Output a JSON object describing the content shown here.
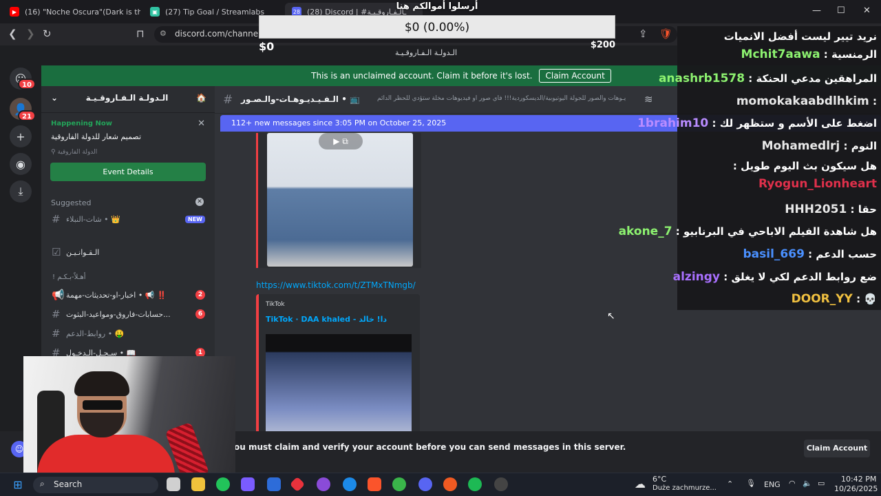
{
  "browser": {
    "tabs": [
      {
        "label": "(16) \"Noche Oscura\"(Dark is the Nigh",
        "icon": "youtube-icon",
        "color": "#ff0000"
      },
      {
        "label": "(27) Tip Goal / Streamlabs",
        "icon": "streamlabs-icon",
        "color": "#31c3a2"
      },
      {
        "label": "(28) Discord | #ـالـفـاروقـيـة",
        "icon": "discord-icon",
        "color": "#5865f2"
      }
    ],
    "url": "discord.com/channels/1",
    "window_controls": [
      "—",
      "☐",
      "✕"
    ]
  },
  "tip_goal": {
    "title": "أرسلوا أموالكم هنا",
    "amount": "$0 (0.00%)",
    "progress": 0.0,
    "min": "$0",
    "max": "$200",
    "server_label": "الـدولـة الـفـاروقـيـة"
  },
  "discord": {
    "banner": {
      "text": "This is an unclaimed account. Claim it before it's lost.",
      "button": "Claim Account"
    },
    "server_rail_badges": [
      "10",
      "21"
    ],
    "server_name": "الـدولـة الـفـاروقـيـة",
    "event": {
      "status": "Happening Now",
      "title": "تصميم شعار للدولة الفاروقية",
      "location": "الدولة الفاروقية",
      "button": "Event Details"
    },
    "suggested_label": "Suggested",
    "channels": [
      {
        "name": "شات-النبلاء • 👑",
        "badge": "",
        "new": "NEW"
      },
      {
        "name": "الـقـوانـيـن",
        "badge": "",
        "new": ""
      },
      {
        "name": "! أهـلاً-بـكـم",
        "badge": "",
        "new": ""
      },
      {
        "name": "اخبار-او-تحديثات-مهمة • 📢 ‼️",
        "badge": "2",
        "new": ""
      },
      {
        "name": "حسابات-فاروق-ومواعيد-البثوت...",
        "badge": "6",
        "new": ""
      },
      {
        "name": "روابط-الدعم • 🤑",
        "badge": "",
        "new": ""
      },
      {
        "name": "سـجـل-الـدخـول • 📖",
        "badge": "1",
        "new": ""
      }
    ],
    "chat": {
      "channel_title": "الـفـيـديـوهـات-والـصـور • 📺",
      "topic": "يـوهات والصور للجولة اليوتيوبية/الديسكوردية!!! فاي صور او فيديوهات مخلة ستؤدي للحظر الدائم",
      "new_messages": "112+ new messages since 3:05 PM on October 25, 2025",
      "link": "https://www.tiktok.com/t/ZTMxTNmgb/",
      "embed_provider": "TikTok",
      "embed_title": "TikTok · DAA khaled - دا! خالد"
    },
    "bottom": {
      "message": "ou must claim and verify your account before you can send messages in this server.",
      "button": "Claim Account"
    }
  },
  "stream_chat": [
    {
      "user": "Mchit7aawa",
      "user_color": "#8df270",
      "text": "نريد تيير ليست أفضل الانميات الرمنسية"
    },
    {
      "user": "anashrb1578",
      "user_color": "#8df270",
      "text": "المراهقين مدعي الحنكة"
    },
    {
      "user": "momokakaabdlhkim",
      "user_color": "#e8e8e8",
      "text": ""
    },
    {
      "user": "1brahim10",
      "user_color": "#b98cff",
      "text": "اضغط على الأسم و ستظهر لك"
    },
    {
      "user": "Mohamedlrj",
      "user_color": "#e8e8e8",
      "text": "النوم"
    },
    {
      "user": "Ryogun_Lionheart",
      "user_color": "#e0304b",
      "text": "هل سيكون بث اليوم طويل"
    },
    {
      "user": "HHH2051",
      "user_color": "#e8e8e8",
      "text": "حقا"
    },
    {
      "user": "akone_7",
      "user_color": "#8df270",
      "text": "هل شاهدة الفيلم الاباحي في البرنابيو"
    },
    {
      "user": "basil_669",
      "user_color": "#4a90ff",
      "text": "حسب الدعم"
    },
    {
      "user": "alzingy",
      "user_color": "#a970ff",
      "text": "ضع روابط الدعم لكي لا يغلق"
    },
    {
      "user": "DOOR_YY",
      "user_color": "#f0c040",
      "text": "💀"
    }
  ],
  "taskbar": {
    "search": "Search",
    "weather_temp": "6°C",
    "weather_desc": "Duże zachmurze...",
    "lang": "ENG",
    "time": "10:42 PM",
    "date": "10/26/2025"
  }
}
